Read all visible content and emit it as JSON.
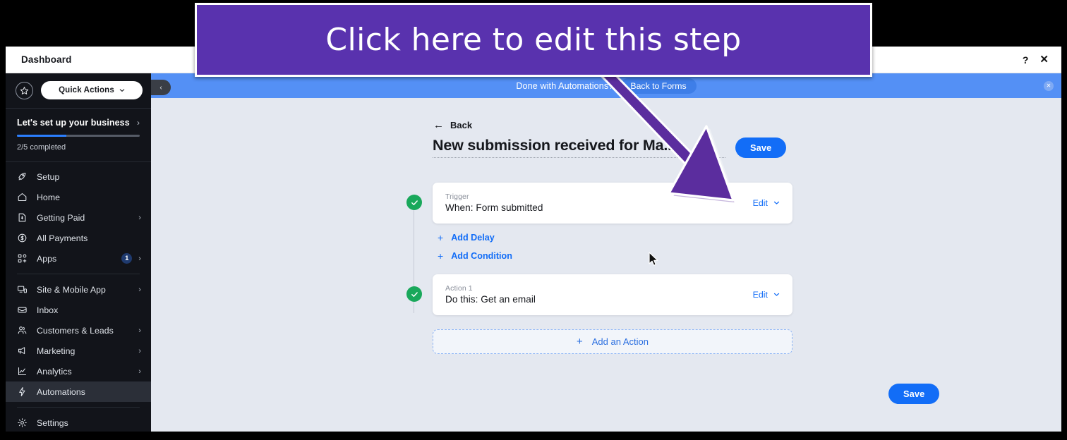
{
  "window": {
    "title": "Dashboard",
    "help_icon": "?",
    "close_icon": "✕"
  },
  "sidebar": {
    "quick_actions": {
      "label": "Quick Actions",
      "star_icon": "star-icon",
      "chevron_icon": "chevron-down-icon"
    },
    "setup": {
      "title": "Let's set up your business",
      "progress_label": "2/5 completed",
      "progress_percent": 40,
      "chevron": "›"
    },
    "items": [
      {
        "label": "Setup",
        "icon": "rocket-icon",
        "chevron": "",
        "badge": ""
      },
      {
        "label": "Home",
        "icon": "home-icon",
        "chevron": "",
        "badge": ""
      },
      {
        "label": "Getting Paid",
        "icon": "invoice-dollar-icon",
        "chevron": "›",
        "badge": ""
      },
      {
        "label": "All Payments",
        "icon": "dollar-circle-icon",
        "chevron": "",
        "badge": ""
      },
      {
        "label": "Apps",
        "icon": "apps-grid-icon",
        "chevron": "›",
        "badge": "1"
      },
      {
        "label": "Site & Mobile App",
        "icon": "monitor-mobile-icon",
        "chevron": "›",
        "badge": ""
      },
      {
        "label": "Inbox",
        "icon": "inbox-icon",
        "chevron": "",
        "badge": ""
      },
      {
        "label": "Customers & Leads",
        "icon": "people-icon",
        "chevron": "›",
        "badge": ""
      },
      {
        "label": "Marketing",
        "icon": "megaphone-icon",
        "chevron": "›",
        "badge": ""
      },
      {
        "label": "Analytics",
        "icon": "chart-line-icon",
        "chevron": "›",
        "badge": ""
      },
      {
        "label": "Automations",
        "icon": "lightning-icon",
        "chevron": "",
        "badge": ""
      },
      {
        "label": "Settings",
        "icon": "gear-icon",
        "chevron": "",
        "badge": ""
      }
    ],
    "active_item": "Automations"
  },
  "top_banner": {
    "message": "Done with Automations?",
    "button_label": "Back to Forms",
    "close_icon": "✕",
    "collapse_icon": "‹",
    "background_color": "#5490F5"
  },
  "main": {
    "back_label": "Back",
    "back_arrow": "←",
    "automation_title": "New submission received for Ma...",
    "save_label": "Save",
    "save_label_bottom": "Save",
    "steps": [
      {
        "kicker": "Trigger",
        "text": "When: Form submitted",
        "edit_label": "Edit",
        "status": "complete"
      },
      {
        "kicker": "Action 1",
        "text": "Do this: Get an email",
        "edit_label": "Edit",
        "status": "complete"
      }
    ],
    "add_links": [
      {
        "label": "Add Delay",
        "icon": "plus-icon"
      },
      {
        "label": "Add Condition",
        "icon": "plus-icon"
      }
    ],
    "add_action_label": "Add an Action",
    "add_action_icon": "plus-icon"
  },
  "callout": {
    "text": "Click here to edit this step",
    "background_color": "#5932AE",
    "arrow_color": "#5B2D9E"
  },
  "colors": {
    "accent_blue": "#126DF7",
    "banner_blue": "#5490F5",
    "success_green": "#19A85B",
    "page_background": "#E4E8F0",
    "sidebar_background": "#12141A"
  }
}
